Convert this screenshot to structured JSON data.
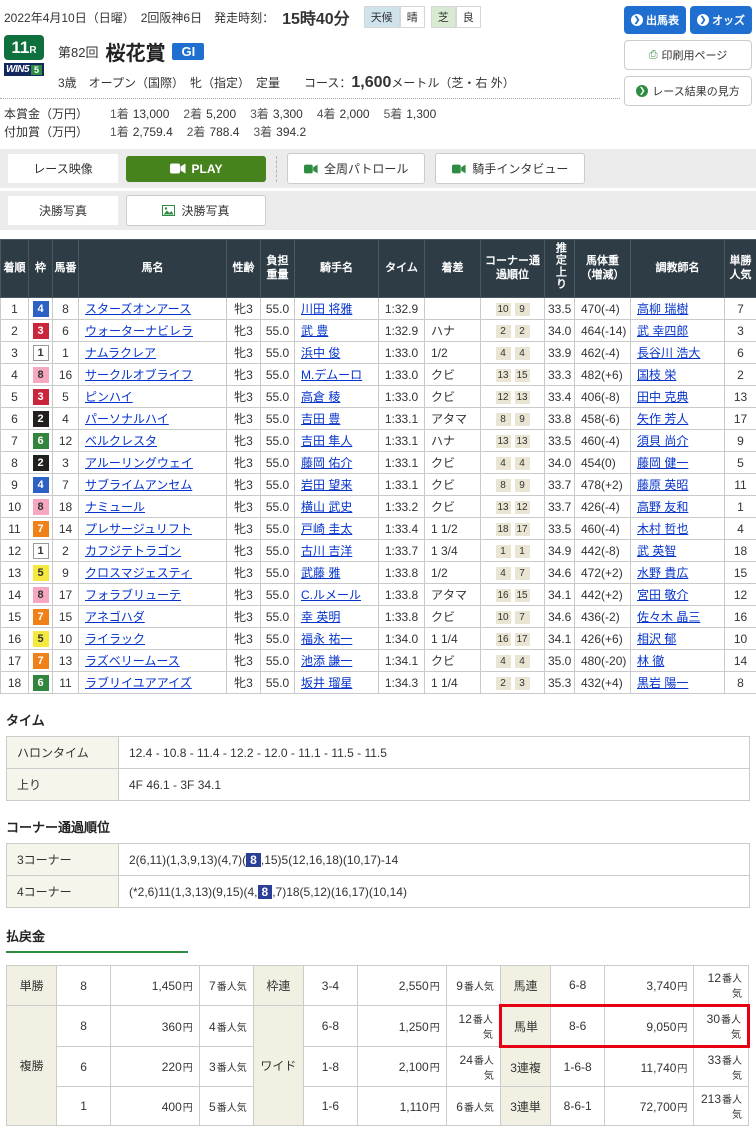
{
  "colors": {
    "accent_blue": "#1e6fd0",
    "jra_green": "#0e713d",
    "play_green": "#47831d",
    "table_header": "#2e3c46",
    "highlight_red": "#e60012",
    "corner_mark_navy": "#2c3f96",
    "link_blue": "#0633cc"
  },
  "header": {
    "date_text": "2022年4月10日（日曜）　2回阪神6日　発走時刻：",
    "start_time": "15時40分",
    "weather": {
      "label1": "天候",
      "value1": "晴",
      "label2": "芝",
      "value2": "良"
    },
    "buttons": {
      "entry": "出馬表",
      "odds": "オッズ",
      "print": "印刷用ページ",
      "guide": "レース結果の見方",
      "entry_icon": "chevron-circle-icon",
      "odds_icon": "chevron-circle-icon",
      "print_icon": "printer-icon",
      "guide_icon": "chevron-circle-icon"
    }
  },
  "race": {
    "number": "11",
    "number_suffix": "R",
    "win5_text": "WIN5",
    "win5_five": "5",
    "edition": "第82回",
    "title": "桜花賞",
    "grade": "GI",
    "conditions_pre": "3歳　オープン（国際）　牝（指定）　定量　　コース：",
    "distance": "1,600",
    "conditions_post": "メートル（芝・右 外）"
  },
  "prize": {
    "main_label": "本賞金（万円）",
    "main": [
      {
        "place": "1着",
        "amount": "13,000"
      },
      {
        "place": "2着",
        "amount": "5,200"
      },
      {
        "place": "3着",
        "amount": "3,300"
      },
      {
        "place": "4着",
        "amount": "2,000"
      },
      {
        "place": "5着",
        "amount": "1,300"
      }
    ],
    "added_label": "付加賞（万円）",
    "added": [
      {
        "place": "1着",
        "amount": "2,759.4"
      },
      {
        "place": "2着",
        "amount": "788.4"
      },
      {
        "place": "3着",
        "amount": "394.2"
      }
    ]
  },
  "media": {
    "race_video_label": "レース映像",
    "play": "PLAY",
    "play_icon": "video-camera-icon",
    "patrol": "全周パトロール",
    "patrol_icon": "video-camera-icon",
    "interview": "騎手インタビュー",
    "interview_icon": "video-camera-icon",
    "photo_label": "決勝写真",
    "photo_button": "決勝写真",
    "photo_icon": "photo-icon"
  },
  "results": {
    "columns": [
      "着順",
      "枠",
      "馬番",
      "馬名",
      "性齢",
      "負担重量",
      "騎手名",
      "タイム",
      "着差",
      "コーナー通過順位",
      "推定上り",
      "馬体重（増減）",
      "調教師名",
      "単勝人気"
    ],
    "rows": [
      {
        "pos": "1",
        "frame": 4,
        "num": "8",
        "name": "スターズオンアース",
        "sex_age": "牝3",
        "weight": "55.0",
        "jockey": "川田 将雅",
        "time": "1:32.9",
        "margin": "",
        "corners": [
          "10",
          "9"
        ],
        "agari": "33.5",
        "horse_weight": "470(-4)",
        "trainer": "高柳 瑞樹",
        "pop": "7"
      },
      {
        "pos": "2",
        "frame": 3,
        "num": "6",
        "name": "ウォーターナビレラ",
        "sex_age": "牝3",
        "weight": "55.0",
        "jockey": "武 豊",
        "time": "1:32.9",
        "margin": "ハナ",
        "corners": [
          "2",
          "2"
        ],
        "agari": "34.0",
        "horse_weight": "464(-14)",
        "trainer": "武 幸四郎",
        "pop": "3"
      },
      {
        "pos": "3",
        "frame": 1,
        "num": "1",
        "name": "ナムラクレア",
        "sex_age": "牝3",
        "weight": "55.0",
        "jockey": "浜中 俊",
        "time": "1:33.0",
        "margin": "1/2",
        "corners": [
          "4",
          "4"
        ],
        "agari": "33.9",
        "horse_weight": "462(-4)",
        "trainer": "長谷川 浩大",
        "pop": "6"
      },
      {
        "pos": "4",
        "frame": 8,
        "num": "16",
        "name": "サークルオブライフ",
        "sex_age": "牝3",
        "weight": "55.0",
        "jockey": "M.デムーロ",
        "time": "1:33.0",
        "margin": "クビ",
        "corners": [
          "13",
          "15"
        ],
        "agari": "33.3",
        "horse_weight": "482(+6)",
        "trainer": "国枝 栄",
        "pop": "2"
      },
      {
        "pos": "5",
        "frame": 3,
        "num": "5",
        "name": "ピンハイ",
        "sex_age": "牝3",
        "weight": "55.0",
        "jockey": "高倉 稜",
        "time": "1:33.0",
        "margin": "クビ",
        "corners": [
          "12",
          "13"
        ],
        "agari": "33.4",
        "horse_weight": "406(-8)",
        "trainer": "田中 克典",
        "pop": "13"
      },
      {
        "pos": "6",
        "frame": 2,
        "num": "4",
        "name": "パーソナルハイ",
        "sex_age": "牝3",
        "weight": "55.0",
        "jockey": "吉田 豊",
        "time": "1:33.1",
        "margin": "アタマ",
        "corners": [
          "8",
          "9"
        ],
        "agari": "33.8",
        "horse_weight": "458(-6)",
        "trainer": "矢作 芳人",
        "pop": "17"
      },
      {
        "pos": "7",
        "frame": 6,
        "num": "12",
        "name": "ベルクレスタ",
        "sex_age": "牝3",
        "weight": "55.0",
        "jockey": "吉田 隼人",
        "time": "1:33.1",
        "margin": "ハナ",
        "corners": [
          "13",
          "13"
        ],
        "agari": "33.5",
        "horse_weight": "460(-4)",
        "trainer": "須貝 尚介",
        "pop": "9"
      },
      {
        "pos": "8",
        "frame": 2,
        "num": "3",
        "name": "アルーリングウェイ",
        "sex_age": "牝3",
        "weight": "55.0",
        "jockey": "藤岡 佑介",
        "time": "1:33.1",
        "margin": "クビ",
        "corners": [
          "4",
          "4"
        ],
        "agari": "34.0",
        "horse_weight": "454(0)",
        "trainer": "藤岡 健一",
        "pop": "5"
      },
      {
        "pos": "9",
        "frame": 4,
        "num": "7",
        "name": "サブライムアンセム",
        "sex_age": "牝3",
        "weight": "55.0",
        "jockey": "岩田 望来",
        "time": "1:33.1",
        "margin": "クビ",
        "corners": [
          "8",
          "9"
        ],
        "agari": "33.7",
        "horse_weight": "478(+2)",
        "trainer": "藤原 英昭",
        "pop": "11"
      },
      {
        "pos": "10",
        "frame": 8,
        "num": "18",
        "name": "ナミュール",
        "sex_age": "牝3",
        "weight": "55.0",
        "jockey": "横山 武史",
        "time": "1:33.2",
        "margin": "クビ",
        "corners": [
          "13",
          "12"
        ],
        "agari": "33.7",
        "horse_weight": "426(-4)",
        "trainer": "高野 友和",
        "pop": "1"
      },
      {
        "pos": "11",
        "frame": 7,
        "num": "14",
        "name": "プレサージュリフト",
        "sex_age": "牝3",
        "weight": "55.0",
        "jockey": "戸崎 圭太",
        "time": "1:33.4",
        "margin": "1 1/2",
        "corners": [
          "18",
          "17"
        ],
        "agari": "33.5",
        "horse_weight": "460(-4)",
        "trainer": "木村 哲也",
        "pop": "4"
      },
      {
        "pos": "12",
        "frame": 1,
        "num": "2",
        "name": "カフジテトラゴン",
        "sex_age": "牝3",
        "weight": "55.0",
        "jockey": "古川 吉洋",
        "time": "1:33.7",
        "margin": "1 3/4",
        "corners": [
          "1",
          "1"
        ],
        "agari": "34.9",
        "horse_weight": "442(-8)",
        "trainer": "武 英智",
        "pop": "18"
      },
      {
        "pos": "13",
        "frame": 5,
        "num": "9",
        "name": "クロスマジェスティ",
        "sex_age": "牝3",
        "weight": "55.0",
        "jockey": "武藤 雅",
        "time": "1:33.8",
        "margin": "1/2",
        "corners": [
          "4",
          "7"
        ],
        "agari": "34.6",
        "horse_weight": "472(+2)",
        "trainer": "水野 貴広",
        "pop": "15"
      },
      {
        "pos": "14",
        "frame": 8,
        "num": "17",
        "name": "フォラブリューテ",
        "sex_age": "牝3",
        "weight": "55.0",
        "jockey": "C.ルメール",
        "time": "1:33.8",
        "margin": "アタマ",
        "corners": [
          "16",
          "15"
        ],
        "agari": "34.1",
        "horse_weight": "442(+2)",
        "trainer": "宮田 敬介",
        "pop": "12"
      },
      {
        "pos": "15",
        "frame": 7,
        "num": "15",
        "name": "アネゴハダ",
        "sex_age": "牝3",
        "weight": "55.0",
        "jockey": "幸 英明",
        "time": "1:33.8",
        "margin": "クビ",
        "corners": [
          "10",
          "7"
        ],
        "agari": "34.6",
        "horse_weight": "436(-2)",
        "trainer": "佐々木 晶三",
        "pop": "16"
      },
      {
        "pos": "16",
        "frame": 5,
        "num": "10",
        "name": "ライラック",
        "sex_age": "牝3",
        "weight": "55.0",
        "jockey": "福永 祐一",
        "time": "1:34.0",
        "margin": "1 1/4",
        "corners": [
          "16",
          "17"
        ],
        "agari": "34.1",
        "horse_weight": "426(+6)",
        "trainer": "相沢 郁",
        "pop": "10"
      },
      {
        "pos": "17",
        "frame": 7,
        "num": "13",
        "name": "ラズベリームース",
        "sex_age": "牝3",
        "weight": "55.0",
        "jockey": "池添 謙一",
        "time": "1:34.1",
        "margin": "クビ",
        "corners": [
          "4",
          "4"
        ],
        "agari": "35.0",
        "horse_weight": "480(-20)",
        "trainer": "林 徹",
        "pop": "14"
      },
      {
        "pos": "18",
        "frame": 6,
        "num": "11",
        "name": "ラブリイユアアイズ",
        "sex_age": "牝3",
        "weight": "55.0",
        "jockey": "坂井 瑠星",
        "time": "1:34.3",
        "margin": "1 1/4",
        "corners": [
          "2",
          "3"
        ],
        "agari": "35.3",
        "horse_weight": "432(+4)",
        "trainer": "黒岩 陽一",
        "pop": "8"
      }
    ]
  },
  "time_section": {
    "heading": "タイム",
    "halon_label": "ハロンタイム",
    "halon_value": "12.4 - 10.8 - 11.4 - 12.2 - 12.0 - 11.1 - 11.5 - 11.5",
    "agari_label": "上り",
    "agari_value": "4F 46.1 - 3F 34.1"
  },
  "corner_section": {
    "heading": "コーナー通過順位",
    "c3_label": "3コーナー",
    "c3_pre": "2(6,11)(1,3,9,13)(4,7)(",
    "c3_mark": "8",
    "c3_post": ",15)5(12,16,18)(10,17)-14",
    "c4_label": "4コーナー",
    "c4_pre": "(*2,6)11(1,3,13)(9,15)(4,",
    "c4_mark": "8",
    "c4_post": ",7)18(5,12)(16,17)(10,14)"
  },
  "payout": {
    "heading": "払戻金",
    "yen_suffix": "円",
    "ninki_suffix": "番人気",
    "groups": [
      {
        "labels": [
          {
            "text": "単勝",
            "span": 1
          },
          {
            "text": "複勝",
            "span": 3
          }
        ],
        "rows": [
          {
            "combo": "8",
            "amount": "1,450",
            "ninki": "7"
          },
          {
            "combo": "8",
            "amount": "360",
            "ninki": "4"
          },
          {
            "combo": "6",
            "amount": "220",
            "ninki": "3"
          },
          {
            "combo": "1",
            "amount": "400",
            "ninki": "5"
          }
        ]
      },
      {
        "labels": [
          {
            "text": "枠連",
            "span": 1
          },
          {
            "text": "ワイド",
            "span": 3
          }
        ],
        "rows": [
          {
            "combo": "3-4",
            "amount": "2,550",
            "ninki": "9"
          },
          {
            "combo": "6-8",
            "amount": "1,250",
            "ninki": "12"
          },
          {
            "combo": "1-8",
            "amount": "2,100",
            "ninki": "24"
          },
          {
            "combo": "1-6",
            "amount": "1,110",
            "ninki": "6"
          }
        ]
      },
      {
        "labels": [
          {
            "text": "馬連",
            "span": 1
          },
          {
            "text": "馬単",
            "span": 1
          },
          {
            "text": "3連複",
            "span": 1
          },
          {
            "text": "3連単",
            "span": 1
          }
        ],
        "rows": [
          {
            "combo": "6-8",
            "amount": "3,740",
            "ninki": "12"
          },
          {
            "combo": "8-6",
            "amount": "9,050",
            "ninki": "30",
            "highlight": true
          },
          {
            "combo": "1-6-8",
            "amount": "11,740",
            "ninki": "33"
          },
          {
            "combo": "8-6-1",
            "amount": "72,700",
            "ninki": "213"
          }
        ]
      }
    ]
  }
}
